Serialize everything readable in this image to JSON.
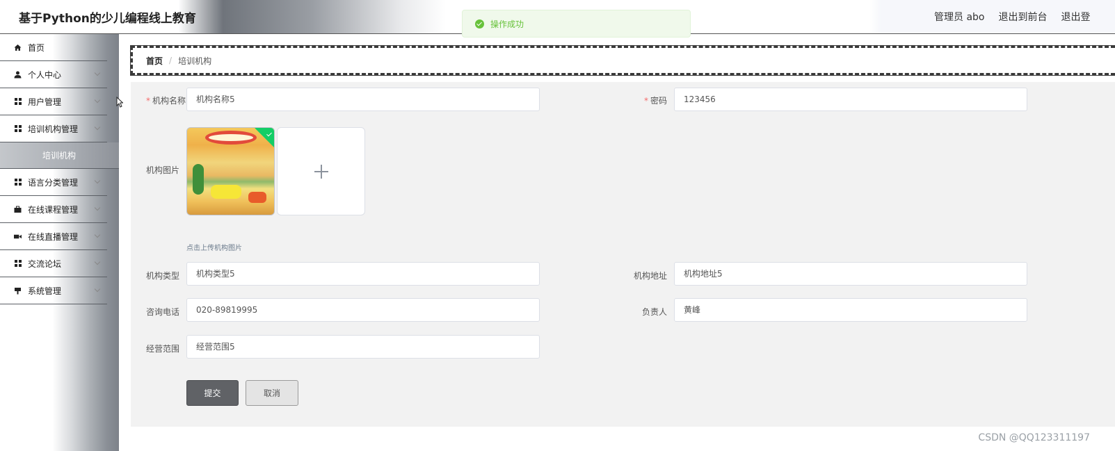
{
  "header": {
    "app_title": "基于Python的少儿编程线上教育",
    "user_label": "管理员 abo",
    "to_front": "退出到前台",
    "logout": "退出登"
  },
  "toast": {
    "message": "操作成功",
    "type": "success"
  },
  "sidebar": {
    "items": [
      {
        "label": "首页",
        "icon": "home-icon",
        "has_children": false
      },
      {
        "label": "个人中心",
        "icon": "user-icon",
        "has_children": true
      },
      {
        "label": "用户管理",
        "icon": "grid-icon",
        "has_children": true
      },
      {
        "label": "培训机构管理",
        "icon": "grid-icon",
        "has_children": true
      },
      {
        "label": "语言分类管理",
        "icon": "grid-icon",
        "has_children": true
      },
      {
        "label": "在线课程管理",
        "icon": "briefcase-icon",
        "has_children": true
      },
      {
        "label": "在线直播管理",
        "icon": "video-icon",
        "has_children": true
      },
      {
        "label": "交流论坛",
        "icon": "grid-icon",
        "has_children": true
      },
      {
        "label": "系统管理",
        "icon": "settings-icon",
        "has_children": true
      }
    ],
    "active_sub": "培训机构"
  },
  "breadcrumb": {
    "home": "首页",
    "separator": "/",
    "current": "培训机构"
  },
  "form": {
    "org_name": {
      "label": "机构名称",
      "value": "机构名称5",
      "required": true
    },
    "password": {
      "label": "密码",
      "value": "123456",
      "required": true
    },
    "image": {
      "label": "机构图片",
      "hint": "点击上传机构图片"
    },
    "org_type": {
      "label": "机构类型",
      "value": "机构类型5"
    },
    "org_address": {
      "label": "机构地址",
      "value": "机构地址5"
    },
    "phone": {
      "label": "咨询电话",
      "value": "020-89819995"
    },
    "manager": {
      "label": "负责人",
      "value": "黄峰"
    },
    "scope": {
      "label": "经营范围",
      "value": "经营范围5"
    },
    "submit_label": "提交",
    "cancel_label": "取消"
  },
  "watermark": "CSDN @QQ123311197",
  "colors": {
    "success": "#67c23a",
    "required": "#f56c6c",
    "panel_bg": "#f2f2f2"
  }
}
